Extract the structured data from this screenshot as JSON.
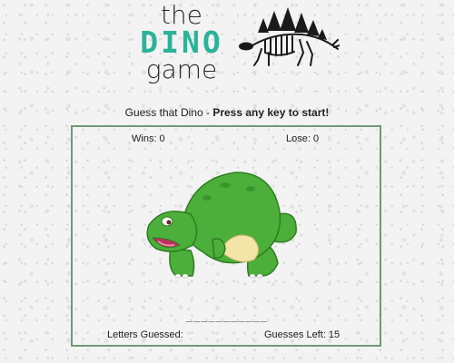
{
  "logo": {
    "line1": "the",
    "line2": "DINO",
    "line3": "game"
  },
  "fossil_icon": "stegosaurus-skeleton-icon",
  "instructions": {
    "prefix": "Guess that Dino - ",
    "strong": "Press any key to start!"
  },
  "score": {
    "wins": "Wins: 0",
    "lose": "Lose: 0"
  },
  "dino_image": "green-cartoon-dinosaur",
  "word_blanks": "___________",
  "letters_guessed": {
    "label": "Letters Guessed:",
    "value": ""
  },
  "guesses_left": "Guesses Left: 15",
  "colors": {
    "accent": "#2bb39a",
    "border": "#6f9a76",
    "dino": "#4caf3a"
  }
}
